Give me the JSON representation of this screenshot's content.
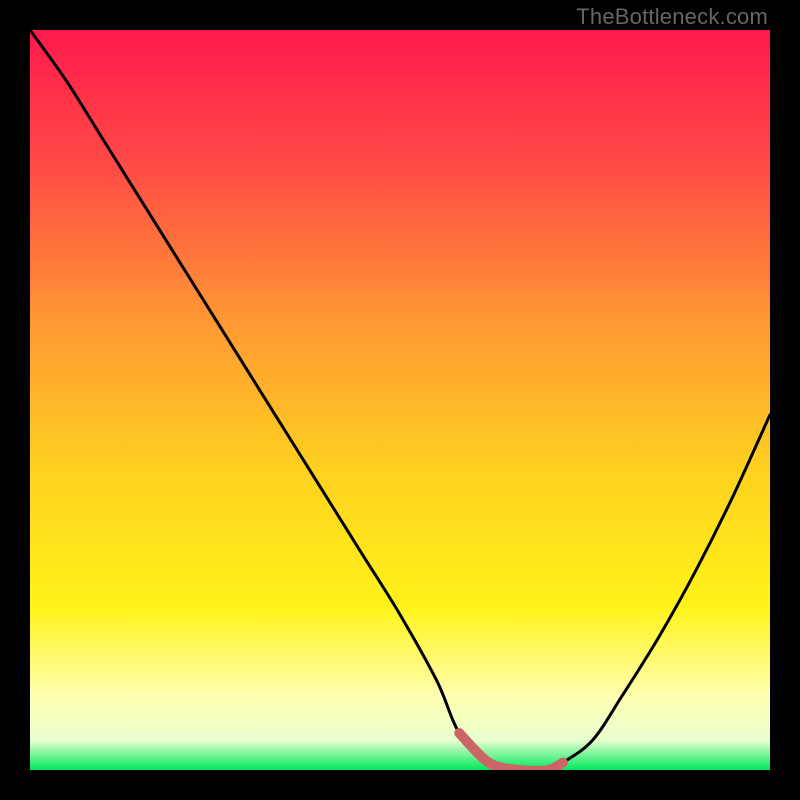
{
  "watermark": "TheBottleneck.com",
  "chart_data": {
    "type": "line",
    "title": "",
    "xlabel": "",
    "ylabel": "",
    "xlim": [
      0,
      100
    ],
    "ylim": [
      0,
      100
    ],
    "series": [
      {
        "name": "bottleneck-curve",
        "x": [
          0,
          5,
          10,
          15,
          20,
          25,
          30,
          35,
          40,
          45,
          50,
          55,
          58,
          62,
          66,
          70,
          72,
          76,
          80,
          85,
          90,
          95,
          100
        ],
        "y": [
          100,
          93,
          85,
          77,
          69,
          61,
          53,
          45,
          37,
          29,
          21,
          12,
          5,
          1,
          0,
          0,
          1,
          4,
          10,
          18,
          27,
          37,
          48
        ],
        "color": "#000000"
      }
    ],
    "highlight": {
      "name": "minimum-band",
      "x": [
        58,
        62,
        66,
        70,
        72
      ],
      "y": [
        5,
        1,
        0,
        0,
        1
      ],
      "color": "#cc6666"
    },
    "gradient_stops": [
      {
        "pos": 0.0,
        "color": "#ff1a4d"
      },
      {
        "pos": 0.18,
        "color": "#ff4a46"
      },
      {
        "pos": 0.4,
        "color": "#ff9a33"
      },
      {
        "pos": 0.6,
        "color": "#ffd21f"
      },
      {
        "pos": 0.78,
        "color": "#fff31a"
      },
      {
        "pos": 0.9,
        "color": "#ffffb0"
      },
      {
        "pos": 0.96,
        "color": "#e8ffd0"
      },
      {
        "pos": 1.0,
        "color": "#00e85c"
      }
    ]
  }
}
